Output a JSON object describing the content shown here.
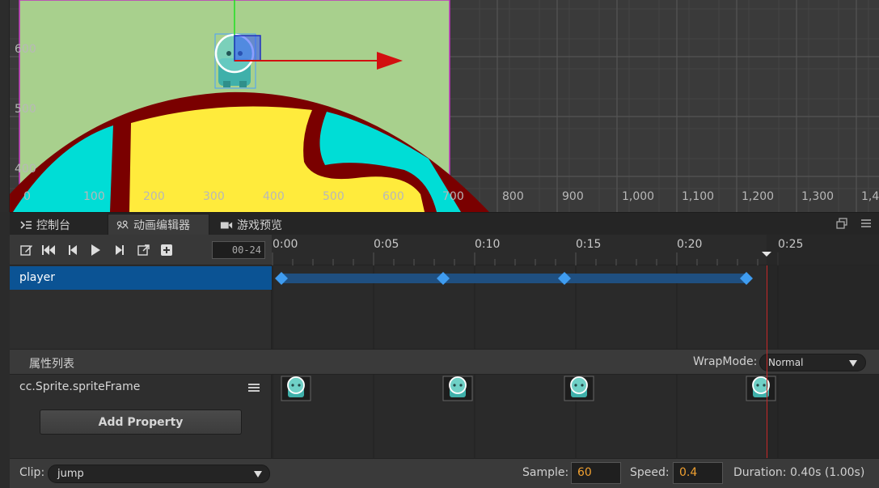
{
  "scene": {
    "ruler_x_labels": [
      "0",
      "100",
      "200",
      "300",
      "400",
      "500",
      "600",
      "700",
      "800",
      "900",
      "1,000",
      "1,100",
      "1,200",
      "1,300",
      "1,4"
    ],
    "ruler_y_labels": [
      "600",
      "500",
      "400"
    ],
    "colors": {
      "background": "#3a3a3a",
      "canvas": "#a8d08d",
      "planet_outline": "#7a0000",
      "sea": "#00ddd6",
      "land": "#ffeb3c"
    }
  },
  "tabs": [
    {
      "label": "控制台",
      "icon": "console-icon",
      "active": false
    },
    {
      "label": "动画编辑器",
      "icon": "animation-icon",
      "active": true
    },
    {
      "label": "游戏预览",
      "icon": "camera-icon",
      "active": false
    }
  ],
  "toolbar": {
    "buttons": [
      "edit-icon",
      "jump-first-icon",
      "prev-frame-icon",
      "play-icon",
      "next-frame-icon",
      "jump-to-icon",
      "add-event-icon"
    ],
    "frame_value": "00-24"
  },
  "timeline": {
    "labels": [
      "0:00",
      "0:05",
      "0:10",
      "0:15",
      "0:20",
      "0:25"
    ],
    "playhead_color": "#c82828"
  },
  "nodes": [
    {
      "name": "player",
      "selected": true
    }
  ],
  "keyframes": {
    "frames": [
      0,
      8,
      14,
      23
    ],
    "color": "#3f9cf0"
  },
  "properties": {
    "title": "属性列表",
    "wrapmode_label": "WrapMode:",
    "wrapmode_value": "Normal",
    "items": [
      {
        "name": "cc.Sprite.spriteFrame"
      }
    ],
    "add_button": "Add Property"
  },
  "footer": {
    "clip_label": "Clip:",
    "clip_value": "jump",
    "sample_label": "Sample:",
    "sample_value": "60",
    "speed_label": "Speed:",
    "speed_value": "0.4",
    "duration_text": "Duration: 0.40s (1.00s)"
  }
}
